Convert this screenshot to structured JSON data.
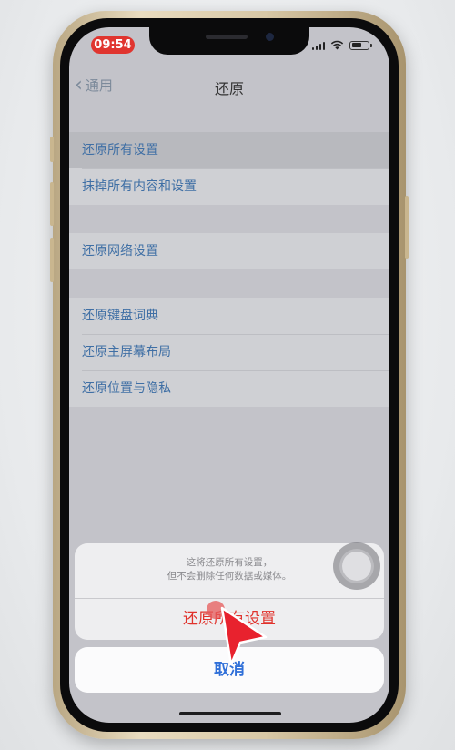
{
  "status_bar": {
    "time": "09:54"
  },
  "nav": {
    "back_label": "通用",
    "title": "还原"
  },
  "settings_groups": [
    {
      "items": [
        {
          "label": "还原所有设置"
        },
        {
          "label": "抹掉所有内容和设置"
        }
      ]
    },
    {
      "items": [
        {
          "label": "还原网络设置"
        }
      ]
    },
    {
      "items": [
        {
          "label": "还原键盘词典"
        },
        {
          "label": "还原主屏幕布局"
        },
        {
          "label": "还原位置与隐私"
        }
      ]
    }
  ],
  "action_sheet": {
    "message_line1": "这将还原所有设置，",
    "message_line2": "但不会删除任何数据或媒体。",
    "destructive_label": "还原所有设置",
    "cancel_label": "取消"
  },
  "colors": {
    "accent_blue": "#2f6fd8",
    "destructive_red": "#e0322c",
    "time_pill_red": "#e0352f"
  },
  "icons": [
    "chevron-left-icon",
    "signal-icon",
    "wifi-icon",
    "battery-icon",
    "assistive-touch-icon",
    "cursor-arrow-icon"
  ]
}
